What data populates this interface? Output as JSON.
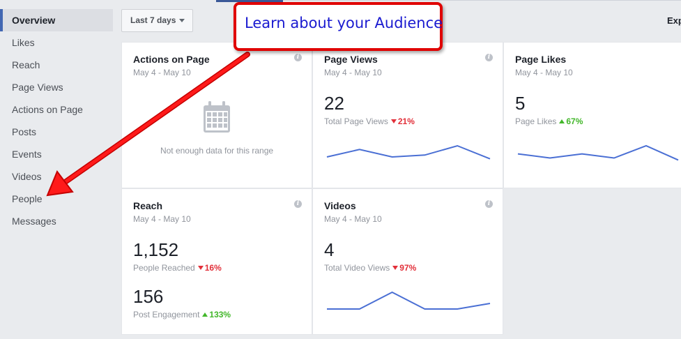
{
  "sidebar": {
    "items": [
      {
        "label": "Overview",
        "active": true
      },
      {
        "label": "Likes"
      },
      {
        "label": "Reach"
      },
      {
        "label": "Page Views"
      },
      {
        "label": "Actions on Page"
      },
      {
        "label": "Posts"
      },
      {
        "label": "Events"
      },
      {
        "label": "Videos"
      },
      {
        "label": "People"
      },
      {
        "label": "Messages"
      }
    ]
  },
  "toolbar": {
    "range_label": "Last 7 days",
    "export_label": "Exp"
  },
  "callout": {
    "text": "Learn about your Audience"
  },
  "cards": {
    "actions": {
      "title": "Actions on Page",
      "date": "May 4 - May 10",
      "info": "i",
      "nodata": "Not enough data for this range"
    },
    "pageviews": {
      "title": "Page Views",
      "date": "May 4 - May 10",
      "info": "i",
      "value": "22",
      "sub": "Total Page Views",
      "change": "21%",
      "direction": "down",
      "spark": [
        3,
        5,
        3,
        3.5,
        6,
        2.5
      ]
    },
    "pagelikes": {
      "title": "Page Likes",
      "date": "May 4 - May 10",
      "info": "i",
      "value": "5",
      "sub": "Page Likes",
      "change": "67%",
      "direction": "up",
      "spark": [
        3.5,
        2.5,
        3.5,
        2.5,
        5.5,
        2
      ]
    },
    "reach": {
      "title": "Reach",
      "date": "May 4 - May 10",
      "info": "i",
      "value": "1,152",
      "sub": "People Reached",
      "change": "16%",
      "direction": "down",
      "value2": "156",
      "sub2": "Post Engagement",
      "change2": "133%",
      "direction2": "up"
    },
    "videos": {
      "title": "Videos",
      "date": "May 4 - May 10",
      "info": "i",
      "value": "4",
      "sub": "Total Video Views",
      "change": "97%",
      "direction": "down",
      "spark": [
        1,
        1,
        4,
        1,
        1,
        2
      ]
    }
  },
  "colors": {
    "accent": "#4267b2",
    "down": "#e2303a",
    "up": "#42b72a",
    "line": "#4a6fd4",
    "callout_border": "#e00000",
    "callout_text": "#1a1ad0"
  }
}
